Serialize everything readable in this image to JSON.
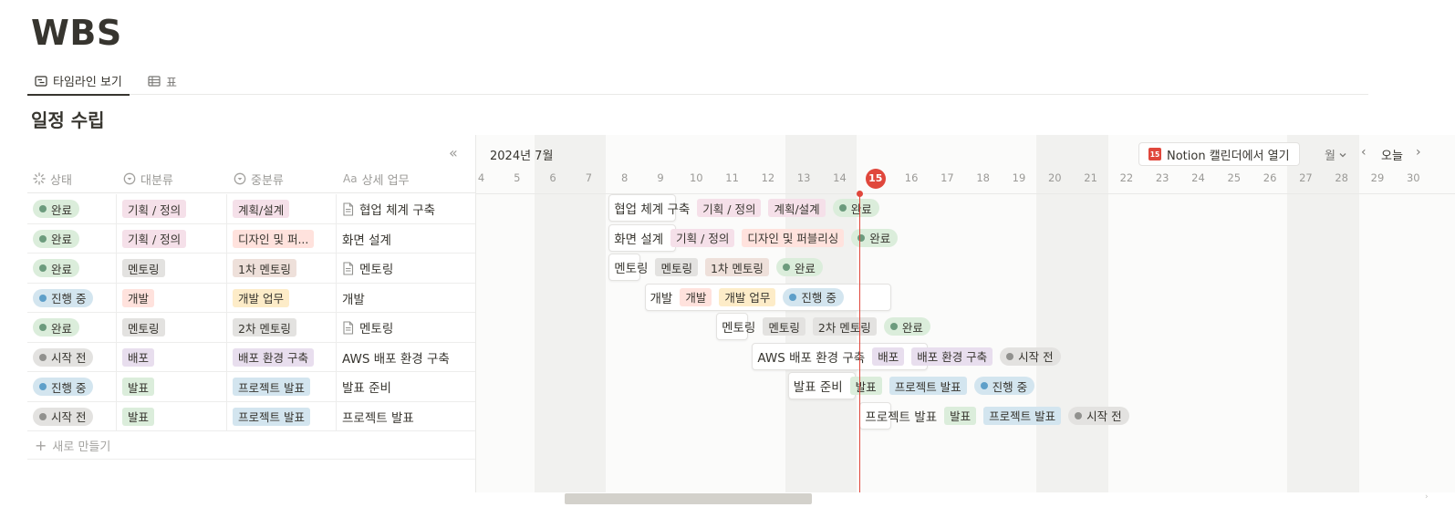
{
  "page": {
    "title": "WBS"
  },
  "views": [
    {
      "label": "타임라인 보기",
      "icon": "timeline-icon",
      "active": true
    },
    {
      "label": "표",
      "icon": "table-icon",
      "active": false
    }
  ],
  "database": {
    "title": "일정 수립"
  },
  "table": {
    "collapse_icon": "«",
    "columns": [
      {
        "label": "상태",
        "icon": "status-icon"
      },
      {
        "label": "대분류",
        "icon": "select-icon"
      },
      {
        "label": "중분류",
        "icon": "select-icon"
      },
      {
        "label": "상세 업무",
        "icon": "title-icon",
        "icon_text": "Aa"
      }
    ],
    "rows": [
      {
        "status": "완료",
        "category": "기획 / 정의",
        "subcategory": "계획/설계",
        "task": "협업 체계 구축",
        "has_doc": true
      },
      {
        "status": "완료",
        "category": "기획 / 정의",
        "subcategory": "디자인 및 퍼...",
        "task": "화면 설계",
        "has_doc": false
      },
      {
        "status": "완료",
        "category": "멘토링",
        "subcategory": "1차 멘토링",
        "task": "멘토링",
        "has_doc": true
      },
      {
        "status": "진행 중",
        "category": "개발",
        "subcategory": "개발 업무",
        "task": "개발",
        "has_doc": false
      },
      {
        "status": "완료",
        "category": "멘토링",
        "subcategory": "2차 멘토링",
        "task": "멘토링",
        "has_doc": true
      },
      {
        "status": "시작 전",
        "category": "배포",
        "subcategory": "배포 환경 구축",
        "task": "AWS 배포 환경 구축",
        "has_doc": false
      },
      {
        "status": "진행 중",
        "category": "발표",
        "subcategory": "프로젝트 발표",
        "task": "발표 준비",
        "has_doc": false
      },
      {
        "status": "시작 전",
        "category": "발표",
        "subcategory": "프로젝트 발표",
        "task": "프로젝트 발표",
        "has_doc": false
      }
    ],
    "new_row_label": "새로 만들기",
    "new_row_icon": "+"
  },
  "timeline": {
    "month_label": "2024년 7월",
    "days": [
      "4",
      "5",
      "6",
      "7",
      "8",
      "9",
      "10",
      "11",
      "12",
      "13",
      "14",
      "15",
      "16",
      "17",
      "18",
      "19",
      "20",
      "21",
      "22",
      "23",
      "24",
      "25",
      "26",
      "27",
      "28",
      "29",
      "30"
    ],
    "today": "15",
    "calendar_button": {
      "label": "Notion 캘린더에서 열기",
      "icon_text": "15"
    },
    "unit_select": "월",
    "today_button": "오늘",
    "prev_icon": "‹",
    "next_icon": "›",
    "bars": [
      {
        "title": "협업 체계 구축",
        "category": "기획 / 정의",
        "subcategory": "계획/설계",
        "status": "완료",
        "start": "8",
        "end": "9"
      },
      {
        "title": "화면 설계",
        "category": "기획 / 정의",
        "subcategory": "디자인 및 퍼블리싱",
        "status": "완료",
        "start": "8",
        "end": "9"
      },
      {
        "title": "멘토링",
        "category": "멘토링",
        "subcategory": "1차 멘토링",
        "status": "완료",
        "start": "8",
        "end": "8"
      },
      {
        "title": "개발",
        "category": "개발",
        "subcategory": "개발 업무",
        "status": "진행 중",
        "start": "9",
        "end": "15"
      },
      {
        "title": "멘토링",
        "category": "멘토링",
        "subcategory": "2차 멘토링",
        "status": "완료",
        "start": "11",
        "end": "11"
      },
      {
        "title": "AWS 배포 환경 구축",
        "category": "배포",
        "subcategory": "배포 환경 구축",
        "status": "시작 전",
        "start": "12",
        "end": "16"
      },
      {
        "title": "발표 준비",
        "category": "발표",
        "subcategory": "프로젝트 발표",
        "status": "진행 중",
        "start": "13",
        "end": "14"
      },
      {
        "title": "프로젝트 발표",
        "category": "발표",
        "subcategory": "프로젝트 발표",
        "status": "시작 전",
        "start": "15",
        "end": "15"
      }
    ]
  },
  "colors": {
    "status": {
      "완료": {
        "bg": "#dbeddb",
        "dot": "#6c9b7d"
      },
      "진행 중": {
        "bg": "#d3e5ef",
        "dot": "#5e9fc9"
      },
      "시작 전": {
        "bg": "#e3e2e0",
        "dot": "#91918e"
      }
    },
    "tags": {
      "기획 / 정의": "#f5e0e9",
      "계획/설계": "#f5e0e9",
      "디자인 및 퍼...": "#ffe2dd",
      "디자인 및 퍼블리싱": "#ffe2dd",
      "멘토링": "#e3e2e0",
      "1차 멘토링": "#eee0da",
      "2차 멘토링": "#e3e2e0",
      "개발": "#ffe2dd",
      "개발 업무": "#fdecc8",
      "배포": "#e8deee",
      "배포 환경 구축": "#e8deee",
      "발표": "#dbeddb",
      "프로젝트 발표": "#d3e5ef"
    },
    "today": "#e0473c"
  }
}
